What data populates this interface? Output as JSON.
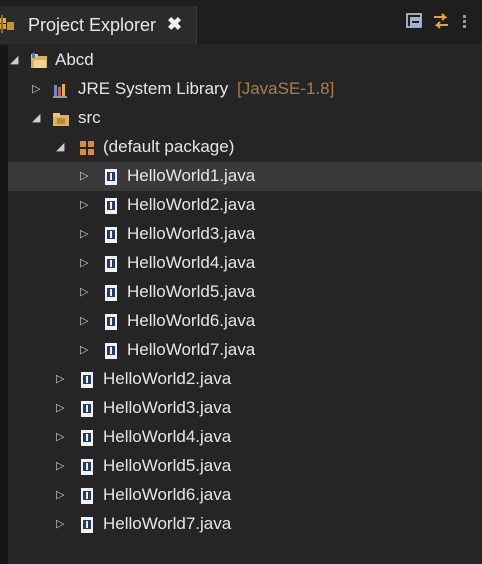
{
  "tab": {
    "title": "Project Explorer",
    "close_glyph": "✖",
    "icon": "package-explorer-icon"
  },
  "toolbar": {
    "buttons": [
      {
        "name": "collapse-all-icon"
      },
      {
        "name": "link-with-editor-icon"
      },
      {
        "name": "view-menu-icon"
      }
    ]
  },
  "tree": {
    "project": {
      "label": "Abcd",
      "icon": "project-folder-icon"
    },
    "jre": {
      "label": "JRE System Library",
      "suffix": "[JavaSE-1.8]",
      "icon": "library-icon"
    },
    "src": {
      "label": "src",
      "icon": "source-folder-icon"
    },
    "package": {
      "label": "(default package)",
      "icon": "package-icon"
    },
    "package_files": [
      "HelloWorld1.java",
      "HelloWorld2.java",
      "HelloWorld3.java",
      "HelloWorld4.java",
      "HelloWorld5.java",
      "HelloWorld6.java",
      "HelloWorld7.java"
    ],
    "src_files": [
      "HelloWorld2.java",
      "HelloWorld3.java",
      "HelloWorld4.java",
      "HelloWorld5.java",
      "HelloWorld6.java",
      "HelloWorld7.java"
    ],
    "selected": "HelloWorld1.java"
  },
  "colors": {
    "background": "#1e1e1e",
    "panel": "#252526",
    "text": "#e6e6e6",
    "library_suffix": "#a77f45",
    "selection": "#3a3a3a"
  }
}
